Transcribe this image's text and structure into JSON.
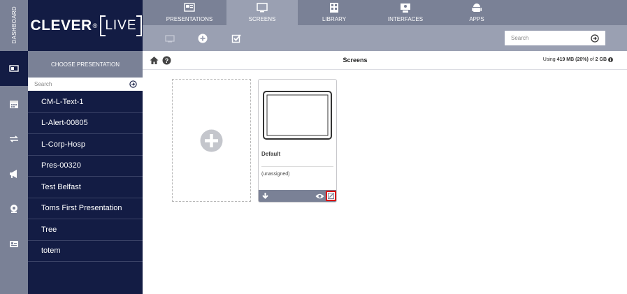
{
  "rail": {
    "dashboard_label": "DASHBOARD",
    "items": [
      {
        "icon": "presentation-icon",
        "active": true
      },
      {
        "icon": "calendar-icon",
        "active": false
      },
      {
        "icon": "transfer-icon",
        "active": false
      },
      {
        "icon": "megaphone-icon",
        "active": false
      },
      {
        "icon": "webcam-icon",
        "active": false
      },
      {
        "icon": "id-card-icon",
        "active": false
      }
    ]
  },
  "logo": {
    "brand": "CLEVER",
    "registered": "®",
    "suffix": "LIVE"
  },
  "sidebar": {
    "header": "CHOOSE PRESENTATION",
    "search_placeholder": "Search",
    "items": [
      {
        "label": "CM-L-Text-1"
      },
      {
        "label": "L-Alert-00805"
      },
      {
        "label": "L-Corp-Hosp"
      },
      {
        "label": "Pres-00320"
      },
      {
        "label": "Test Belfast"
      },
      {
        "label": "Toms First Presentation"
      },
      {
        "label": "Tree"
      },
      {
        "label": "totem"
      }
    ]
  },
  "tabs": [
    {
      "label": "PRESENTATIONS",
      "icon": "presentation-icon",
      "active": false
    },
    {
      "label": "SCREENS",
      "icon": "monitor-icon",
      "active": true
    },
    {
      "label": "LIBRARY",
      "icon": "library-icon",
      "active": false
    },
    {
      "label": "INTERFACES",
      "icon": "interface-icon",
      "active": false
    },
    {
      "label": "APPS",
      "icon": "android-icon",
      "active": false
    }
  ],
  "toolbar": {
    "search_placeholder": "Search"
  },
  "breadcrumb": {
    "title": "Screens",
    "usage_prefix": "Using",
    "usage_used": "419 MB (20%)",
    "usage_of": "of",
    "usage_total": "2 GB"
  },
  "screens": [
    {
      "name": "Default",
      "assignment": "(unassigned)"
    }
  ],
  "colors": {
    "navy": "#131c44",
    "slate": "#7a8196",
    "slate_light": "#9aa0b2",
    "highlight": "#d81515"
  }
}
